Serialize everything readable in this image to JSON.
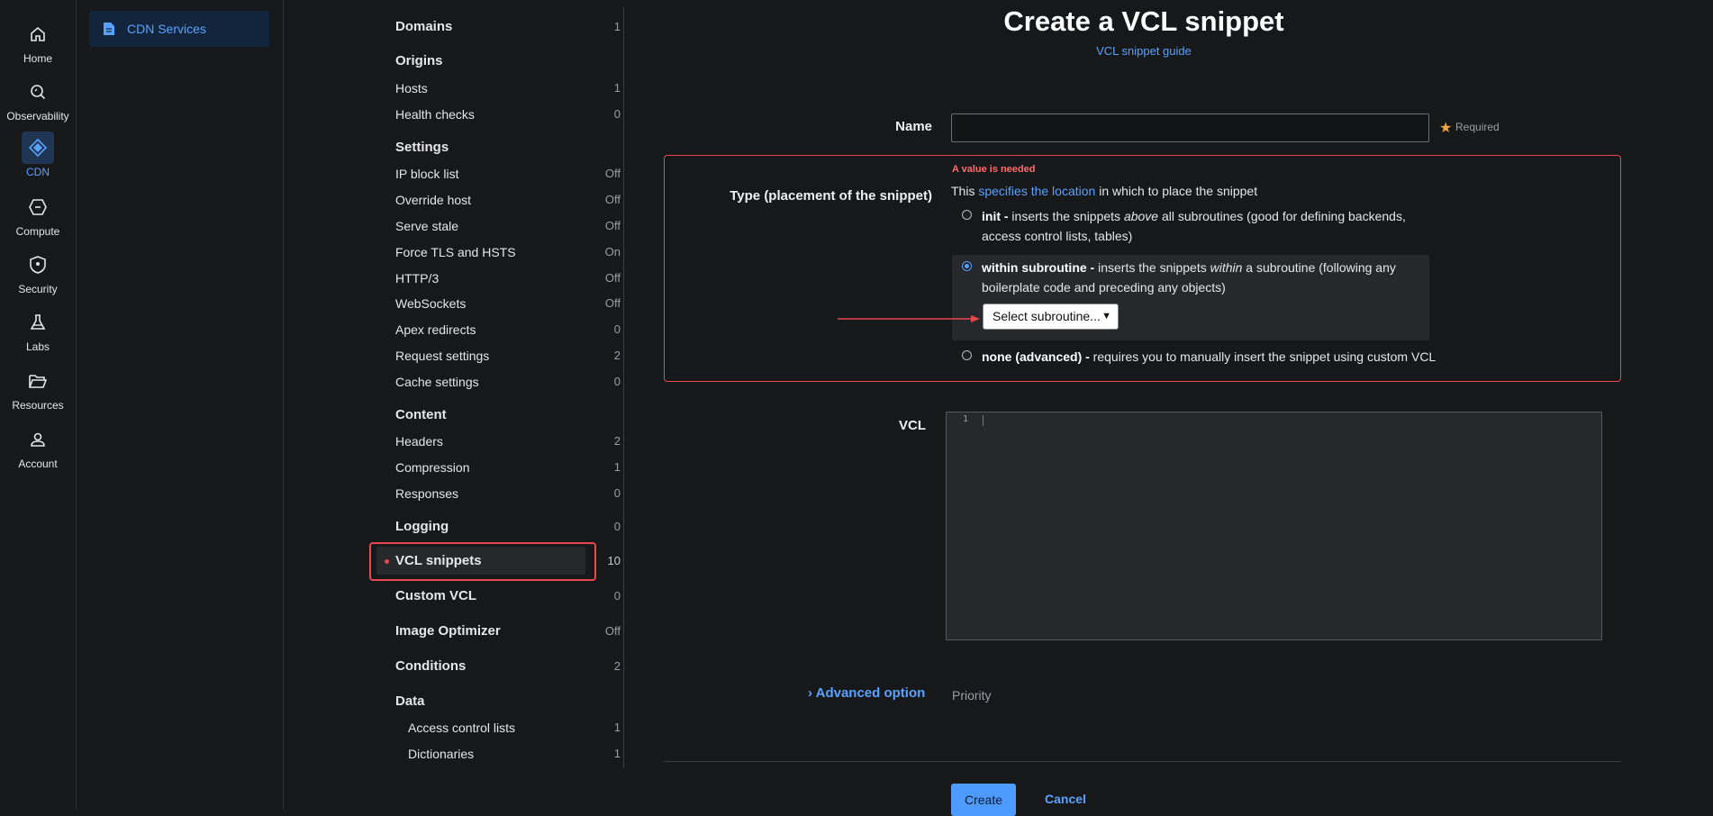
{
  "rail": {
    "items": [
      {
        "label": "Home",
        "icon": "home-icon"
      },
      {
        "label": "Observability",
        "icon": "magnifier-icon"
      },
      {
        "label": "CDN",
        "icon": "cdn-diamond-icon"
      },
      {
        "label": "Compute",
        "icon": "compute-icon"
      },
      {
        "label": "Security",
        "icon": "shield-icon"
      },
      {
        "label": "Labs",
        "icon": "flask-icon"
      },
      {
        "label": "Resources",
        "icon": "folder-icon"
      },
      {
        "label": "Account",
        "icon": "person-icon"
      }
    ]
  },
  "services": {
    "label": "CDN Services"
  },
  "nav": {
    "domains": {
      "label": "Domains",
      "count": "1"
    },
    "origins": {
      "label": "Origins"
    },
    "hosts": {
      "label": "Hosts",
      "count": "1"
    },
    "health_checks": {
      "label": "Health checks",
      "count": "0"
    },
    "settings": {
      "label": "Settings"
    },
    "ip_block_list": {
      "label": "IP block list",
      "count": "Off"
    },
    "override_host": {
      "label": "Override host",
      "count": "Off"
    },
    "serve_stale": {
      "label": "Serve stale",
      "count": "Off"
    },
    "force_tls": {
      "label": "Force TLS and HSTS",
      "count": "On"
    },
    "http3": {
      "label": "HTTP/3",
      "count": "Off"
    },
    "websockets": {
      "label": "WebSockets",
      "count": "Off"
    },
    "apex_redirects": {
      "label": "Apex redirects",
      "count": "0"
    },
    "request_settings": {
      "label": "Request settings",
      "count": "2"
    },
    "cache_settings": {
      "label": "Cache settings",
      "count": "0"
    },
    "content": {
      "label": "Content"
    },
    "headers": {
      "label": "Headers",
      "count": "2"
    },
    "compression": {
      "label": "Compression",
      "count": "1"
    },
    "responses": {
      "label": "Responses",
      "count": "0"
    },
    "logging": {
      "label": "Logging",
      "count": "0"
    },
    "vcl_snippets": {
      "label": "VCL snippets",
      "count": "10"
    },
    "custom_vcl": {
      "label": "Custom VCL",
      "count": "0"
    },
    "image_optimizer": {
      "label": "Image Optimizer",
      "count": "Off"
    },
    "conditions": {
      "label": "Conditions",
      "count": "2"
    },
    "data": {
      "label": "Data"
    },
    "acl": {
      "label": "Access control lists",
      "count": "1"
    },
    "dictionaries": {
      "label": "Dictionaries",
      "count": "1"
    }
  },
  "main": {
    "title": "Create a VCL snippet",
    "guide_link": "VCL snippet guide",
    "name_label": "Name",
    "required_star": "★",
    "required_text": "Required",
    "error": "A value is needed",
    "type_label": "Type (placement of the snippet)",
    "type_desc_pre": "This ",
    "type_desc_link": "specifies the location",
    "type_desc_post": " in which to place the snippet",
    "opt_init_bold": "init -",
    "opt_init_a": " inserts the snippets ",
    "opt_init_em": "above",
    "opt_init_b": " all subroutines (good for defining backends,",
    "opt_init_c": "access control lists, tables)",
    "opt_within_bold": "within subroutine -",
    "opt_within_a": " inserts the snippets ",
    "opt_within_em": "within",
    "opt_within_b": " a subroutine (following any",
    "opt_within_c": "boilerplate code and preceding any objects)",
    "select_value": "Select subroutine...",
    "opt_none_bold": "none (advanced) -",
    "opt_none_text": " requires you to manually insert the snippet using custom VCL",
    "vcl_label": "VCL",
    "line_number": "1",
    "advanced": "Advanced option",
    "priority": "Priority",
    "create": "Create",
    "cancel": "Cancel"
  },
  "colors": {
    "accent": "#5aa2ff",
    "error": "#e5484d",
    "background": "#17181a"
  }
}
